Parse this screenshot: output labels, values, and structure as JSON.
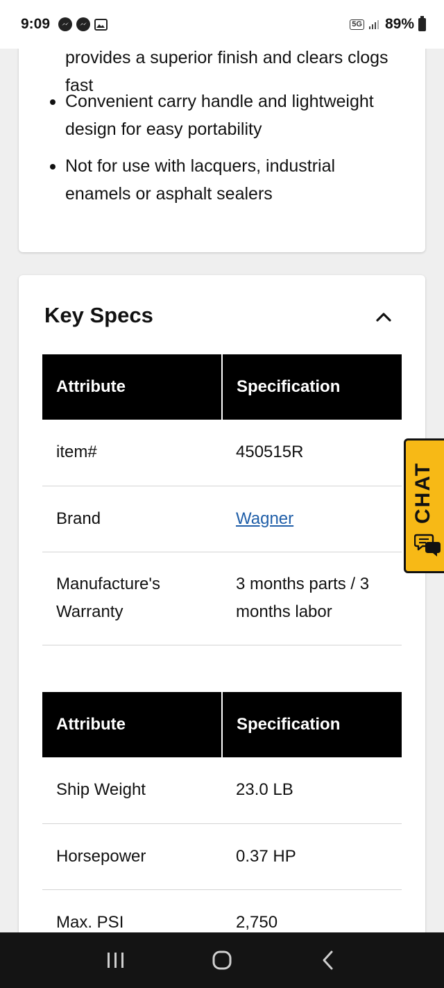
{
  "status_bar": {
    "time": "9:09",
    "network": "5G",
    "battery": "89%"
  },
  "features": {
    "partial_text": "provides a superior finish and clears clogs fast",
    "items": [
      "Convenient carry handle and lightweight design for easy portability",
      "Not for use with lacquers, industrial enamels or asphalt sealers"
    ]
  },
  "key_specs": {
    "title": "Key Specs",
    "table1": {
      "headers": [
        "Attribute",
        "Specification"
      ],
      "rows": [
        [
          "item#",
          "450515R"
        ],
        [
          "Brand",
          "Wagner"
        ],
        [
          "Manufacture's Warranty",
          "3 months parts / 3 months labor"
        ]
      ]
    },
    "table2": {
      "headers": [
        "Attribute",
        "Specification"
      ],
      "rows": [
        [
          "Ship Weight",
          "23.0 LB"
        ],
        [
          "Horsepower",
          "0.37 HP"
        ],
        [
          "Max. PSI",
          "2,750"
        ]
      ]
    }
  },
  "chat": {
    "label": "CHAT"
  },
  "colors": {
    "chat_bg": "#f7b916",
    "header_bg": "#000000",
    "link": "#1f5ea8"
  }
}
